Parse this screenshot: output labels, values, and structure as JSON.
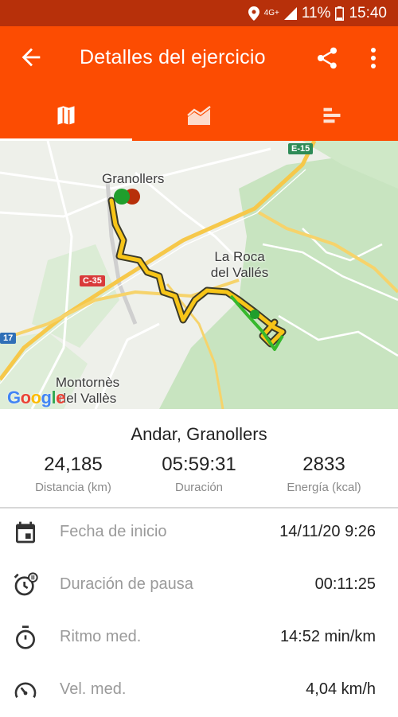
{
  "status_bar": {
    "network": "4G+",
    "battery": "11%",
    "time": "15:40"
  },
  "app_bar": {
    "title": "Detalles del ejercicio"
  },
  "tabs": [
    {
      "name": "map",
      "icon": "map-icon",
      "active": true
    },
    {
      "name": "chart",
      "icon": "area-chart-icon",
      "active": false
    },
    {
      "name": "splits",
      "icon": "bars-icon",
      "active": false
    }
  ],
  "map": {
    "labels": {
      "city1": "Granollers",
      "city2_line1": "La Roca",
      "city2_line2": "del Vallés",
      "city3_line1": "Montornès",
      "city3_line2": "del Vallès",
      "road1": "E-15",
      "road2": "C-35",
      "road3": "17"
    },
    "attribution": "Google"
  },
  "summary": {
    "title": "Andar, Granollers",
    "stats": [
      {
        "value": "24,185",
        "label": "Distancia (km)"
      },
      {
        "value": "05:59:31",
        "label": "Duración"
      },
      {
        "value": "2833",
        "label": "Energía (kcal)"
      }
    ]
  },
  "details": [
    {
      "icon": "calendar-icon",
      "label": "Fecha de inicio",
      "value": "14/11/20 9:26"
    },
    {
      "icon": "pause-timer-icon",
      "label": "Duración de pausa",
      "value": "00:11:25"
    },
    {
      "icon": "stopwatch-icon",
      "label": "Ritmo med.",
      "value": "14:52 min/km"
    },
    {
      "icon": "speedometer-icon",
      "label": "Vel. med.",
      "value": "4,04 km/h"
    }
  ]
}
